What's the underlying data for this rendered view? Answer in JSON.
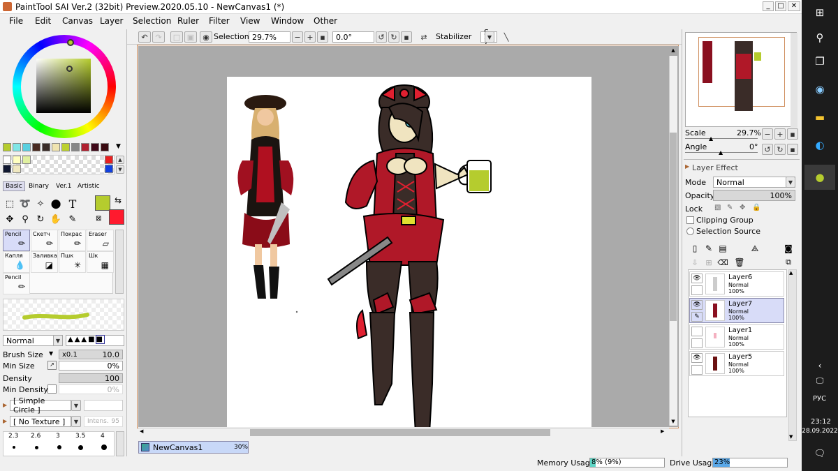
{
  "window": {
    "title": "PaintTool SAI Ver.2 (32bit) Preview.2020.05.10 - NewCanvas1 (*)"
  },
  "menu": [
    "File",
    "Edit",
    "Canvas",
    "Layer",
    "Selection",
    "Ruler",
    "Filter",
    "View",
    "Window",
    "Other"
  ],
  "toolbar": {
    "selection_label": "Selection",
    "zoom": "29.7%",
    "angle": "0.0°",
    "stabilizer_label": "Stabilizer",
    "stabilizer_value": "S-7"
  },
  "brush_tabs": [
    "Basic",
    "Binary",
    "Ver.1",
    "Artistic"
  ],
  "brushes": [
    {
      "label": "Pencil",
      "icon": "pencil-icon"
    },
    {
      "label": "Скетч",
      "icon": "sketch-icon"
    },
    {
      "label": "Покрас",
      "icon": "paint-icon"
    },
    {
      "label": "Eraser",
      "icon": "eraser-icon"
    },
    {
      "label": "Капля",
      "icon": "drop-icon"
    },
    {
      "label": "Заливка",
      "icon": "fill-icon"
    },
    {
      "label": "Пшк",
      "icon": "spray-icon"
    },
    {
      "label": "Шк",
      "icon": "shk-icon"
    },
    {
      "label": "Pencil",
      "icon": "pencil-icon"
    }
  ],
  "brush_settings": {
    "blend_mode": "Normal",
    "brush_size_label": "Brush Size",
    "brush_size_mult": "x0.1",
    "brush_size": "10.0",
    "min_size_label": "Min Size",
    "min_size": "0%",
    "density_label": "Density",
    "density": "100",
    "min_density_label": "Min Density",
    "min_density": "0%",
    "shape": "[ Simple Circle ]",
    "texture": "[ No Texture ]",
    "intens_label": "Intens.",
    "intens": "95",
    "size_presets": [
      "2.3",
      "2.6",
      "3",
      "3.5",
      "4"
    ]
  },
  "colors": {
    "primary": "#b5cc2e",
    "secondary": "#ff1a2e"
  },
  "navigator": {
    "scale_label": "Scale",
    "scale": "29.7%",
    "angle_label": "Angle",
    "angle": "0°"
  },
  "layer_panel": {
    "effect_label": "Layer Effect",
    "mode_label": "Mode",
    "mode": "Normal",
    "opacity_label": "Opacity",
    "opacity": "100%",
    "lock_label": "Lock",
    "clipping_label": "Clipping Group",
    "selection_source_label": "Selection Source",
    "layers": [
      {
        "name": "Layer6",
        "mode": "Normal",
        "opacity": "100%",
        "visible": true,
        "selected": false
      },
      {
        "name": "Layer7",
        "mode": "Normal",
        "opacity": "100%",
        "visible": true,
        "selected": true
      },
      {
        "name": "Layer1",
        "mode": "Normal",
        "opacity": "100%",
        "visible": false,
        "selected": false
      },
      {
        "name": "Layer5",
        "mode": "Normal",
        "opacity": "100%",
        "visible": true,
        "selected": false
      }
    ]
  },
  "canvas_tab": {
    "name": "NewCanvas1",
    "zoom": "30%"
  },
  "status": {
    "memory_label": "Memory Usage",
    "memory_value": "8% (9%)",
    "memory_pct": 8,
    "drive_label": "Drive Usage",
    "drive_value": "23%",
    "drive_pct": 23
  },
  "taskbar": {
    "lang": "РУС",
    "time": "23:12",
    "date": "28.09.2022"
  }
}
